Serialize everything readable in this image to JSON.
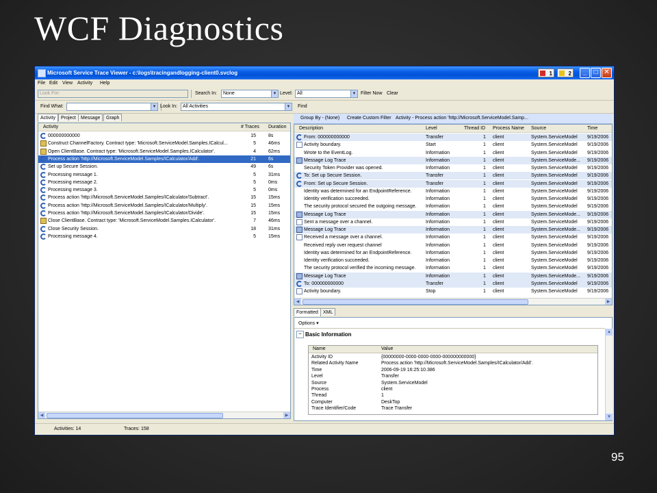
{
  "slide": {
    "title": "WCF Diagnostics",
    "page_number": "95"
  },
  "window": {
    "title": "Microsoft Service Trace Viewer - c:\\logs\\tracingandlogging-client0.svclog",
    "badge1": "1",
    "badge2": "2",
    "minimize": "_",
    "maximize": "□",
    "close": "✕"
  },
  "menu": [
    "File",
    "Edit",
    "View",
    "Activity",
    "Help"
  ],
  "toolbar1": {
    "look_for_placeholder": "Look For:",
    "search_in_label": "Search In:",
    "search_in_value": "None",
    "level_label": "Level:",
    "level_value": "All",
    "filter_now": "Filter Now",
    "clear": "Clear"
  },
  "toolbar2": {
    "find_what_label": "Find What:",
    "look_in_label": "Look In:",
    "look_in_value": "All Activities",
    "find": "Find"
  },
  "left_tabs": [
    "Activity",
    "Project",
    "Message",
    "Graph"
  ],
  "activity_columns": [
    "Activity",
    "# Traces",
    "Duration"
  ],
  "activities": [
    {
      "icon": "activity-icon",
      "name": "000000000000",
      "traces": "15",
      "duration": "8s"
    },
    {
      "icon": "create-icon",
      "name": "Construct ChannelFactory. Contract type: 'Microsoft.ServiceModel.Samples.ICalcul...",
      "traces": "5",
      "duration": "46ms"
    },
    {
      "icon": "create-icon",
      "name": "Open ClientBase. Contract type: 'Microsoft.ServiceModel.Samples.ICalculator'.",
      "traces": "4",
      "duration": "62ms"
    },
    {
      "icon": "activity-icon",
      "name": "Process action 'http://Microsoft.ServiceModel.Samples/ICalculator/Add'.",
      "traces": "21",
      "duration": "6s"
    },
    {
      "icon": "activity-icon",
      "name": "Set up Secure Session.",
      "traces": "49",
      "duration": "6s"
    },
    {
      "icon": "activity-icon",
      "name": "Processing message 1.",
      "traces": "5",
      "duration": "31ms"
    },
    {
      "icon": "activity-icon",
      "name": "Processing message 2.",
      "traces": "5",
      "duration": "0ms"
    },
    {
      "icon": "activity-icon",
      "name": "Processing message 3.",
      "traces": "5",
      "duration": "0ms"
    },
    {
      "icon": "activity-icon",
      "name": "Process action 'http://Microsoft.ServiceModel.Samples/ICalculator/Subtract'.",
      "traces": "15",
      "duration": "15ms"
    },
    {
      "icon": "activity-icon",
      "name": "Process action 'http://Microsoft.ServiceModel.Samples/ICalculator/Multiply'.",
      "traces": "15",
      "duration": "15ms"
    },
    {
      "icon": "activity-icon",
      "name": "Process action 'http://Microsoft.ServiceModel.Samples/ICalculator/Divide'.",
      "traces": "15",
      "duration": "15ms"
    },
    {
      "icon": "create-icon",
      "name": "Close ClientBase. Contract type: 'Microsoft.ServiceModel.Samples.ICalculator'.",
      "traces": "7",
      "duration": "46ms"
    },
    {
      "icon": "activity-icon",
      "name": "Close Security Session.",
      "traces": "18",
      "duration": "31ms"
    },
    {
      "icon": "activity-icon",
      "name": "Processing message 4.",
      "traces": "5",
      "duration": "15ms"
    }
  ],
  "selected_activity_index": 3,
  "groupbar": {
    "group_by": "Group By - (None)",
    "create_filter": "Create Custom Filter",
    "activity": "Activity - Process action 'http://Microsoft.ServiceModel.Samp..."
  },
  "trace_columns": [
    "Description",
    "Level",
    "Thread ID",
    "Process Name",
    "Source",
    "Time"
  ],
  "traces": [
    {
      "icon": "transfer-icon",
      "description": "From: 000000000000",
      "level": "Transfer",
      "thread": "1",
      "process": "client",
      "source": "System.ServiceModel",
      "time": "9/19/2006"
    },
    {
      "icon": "trace-icon",
      "description": "Activity boundary.",
      "level": "Start",
      "thread": "1",
      "process": "client",
      "source": "System.ServiceModel",
      "time": "9/19/2006"
    },
    {
      "icon": "",
      "description": "Wrote to the EventLog.",
      "level": "Information",
      "thread": "1",
      "process": "client",
      "source": "System.ServiceModel",
      "time": "9/19/2006"
    },
    {
      "icon": "message-icon",
      "description": "Message Log Trace",
      "level": "Information",
      "thread": "1",
      "process": "client",
      "source": "System.ServiceMode...",
      "time": "9/19/2006"
    },
    {
      "icon": "",
      "description": "Security Token Provider was opened.",
      "level": "Information",
      "thread": "1",
      "process": "client",
      "source": "System.ServiceModel",
      "time": "9/19/2006"
    },
    {
      "icon": "transfer-icon",
      "description": "To: Set up Secure Session.",
      "level": "Transfer",
      "thread": "1",
      "process": "client",
      "source": "System.ServiceModel",
      "time": "9/19/2006"
    },
    {
      "icon": "transfer-icon",
      "description": "From: Set up Secure Session.",
      "level": "Transfer",
      "thread": "1",
      "process": "client",
      "source": "System.ServiceModel",
      "time": "9/19/2006"
    },
    {
      "icon": "",
      "description": "Identity was determined for an EndpointReference.",
      "level": "Information",
      "thread": "1",
      "process": "client",
      "source": "System.ServiceModel",
      "time": "9/19/2006"
    },
    {
      "icon": "",
      "description": "Identity verification succeeded.",
      "level": "Information",
      "thread": "1",
      "process": "client",
      "source": "System.ServiceModel",
      "time": "9/19/2006"
    },
    {
      "icon": "",
      "description": "The security protocol secured the outgoing message.",
      "level": "Information",
      "thread": "1",
      "process": "client",
      "source": "System.ServiceModel",
      "time": "9/19/2006"
    },
    {
      "icon": "message-icon",
      "description": "Message Log Trace",
      "level": "Information",
      "thread": "1",
      "process": "client",
      "source": "System.ServiceMode...",
      "time": "9/19/2006"
    },
    {
      "icon": "trace-icon",
      "description": "Sent a message over a channel.",
      "level": "Information",
      "thread": "1",
      "process": "client",
      "source": "System.ServiceModel",
      "time": "9/19/2006"
    },
    {
      "icon": "message-icon",
      "description": "Message Log Trace",
      "level": "Information",
      "thread": "1",
      "process": "client",
      "source": "System.ServiceMode...",
      "time": "9/19/2006"
    },
    {
      "icon": "trace-icon",
      "description": "Received a message over a channel.",
      "level": "Information",
      "thread": "1",
      "process": "client",
      "source": "System.ServiceModel",
      "time": "9/19/2006"
    },
    {
      "icon": "",
      "description": "Received reply over request channel",
      "level": "Information",
      "thread": "1",
      "process": "client",
      "source": "System.ServiceModel",
      "time": "9/19/2006"
    },
    {
      "icon": "",
      "description": "Identity was determined for an EndpointReference.",
      "level": "Information",
      "thread": "1",
      "process": "client",
      "source": "System.ServiceModel",
      "time": "9/19/2006"
    },
    {
      "icon": "",
      "description": "Identity verification succeeded.",
      "level": "Information",
      "thread": "1",
      "process": "client",
      "source": "System.ServiceModel",
      "time": "9/19/2006"
    },
    {
      "icon": "",
      "description": "The security protocol verified the incoming message.",
      "level": "Information",
      "thread": "1",
      "process": "client",
      "source": "System.ServiceModel",
      "time": "9/19/2006"
    },
    {
      "icon": "message-icon",
      "description": "Message Log Trace",
      "level": "Information",
      "thread": "1",
      "process": "client",
      "source": "System.ServiceMode...",
      "time": "9/19/2006"
    },
    {
      "icon": "transfer-icon",
      "description": "To: 000000000000",
      "level": "Transfer",
      "thread": "1",
      "process": "client",
      "source": "System.ServiceModel",
      "time": "9/19/2006"
    },
    {
      "icon": "trace-icon",
      "description": "Activity boundary.",
      "level": "Stop",
      "thread": "1",
      "process": "client",
      "source": "System.ServiceModel",
      "time": "9/19/2006"
    }
  ],
  "detail_tabs": [
    "Formatted",
    "XML"
  ],
  "detail": {
    "options": "Options ▾",
    "section_title": "Basic Information",
    "columns": [
      "Name",
      "Value"
    ],
    "rows": [
      {
        "name": "Activity ID",
        "value": "{00000000-0000-0000-0000-000000000000}"
      },
      {
        "name": "Related Activity Name",
        "value": "Process action 'http://Microsoft.ServiceModel.Samples/ICalculator/Add'."
      },
      {
        "name": "Time",
        "value": "2006-09-19 16:25:10.386"
      },
      {
        "name": "Level",
        "value": "Transfer"
      },
      {
        "name": "Source",
        "value": "System.ServiceModel"
      },
      {
        "name": "Process",
        "value": "client"
      },
      {
        "name": "Thread",
        "value": "1"
      },
      {
        "name": "Computer",
        "value": "DeskTop"
      },
      {
        "name": "Trace Identifier/Code",
        "value": "Trace Transfer"
      }
    ]
  },
  "status": {
    "activities": "Activities: 14",
    "traces": "Traces: 158"
  }
}
